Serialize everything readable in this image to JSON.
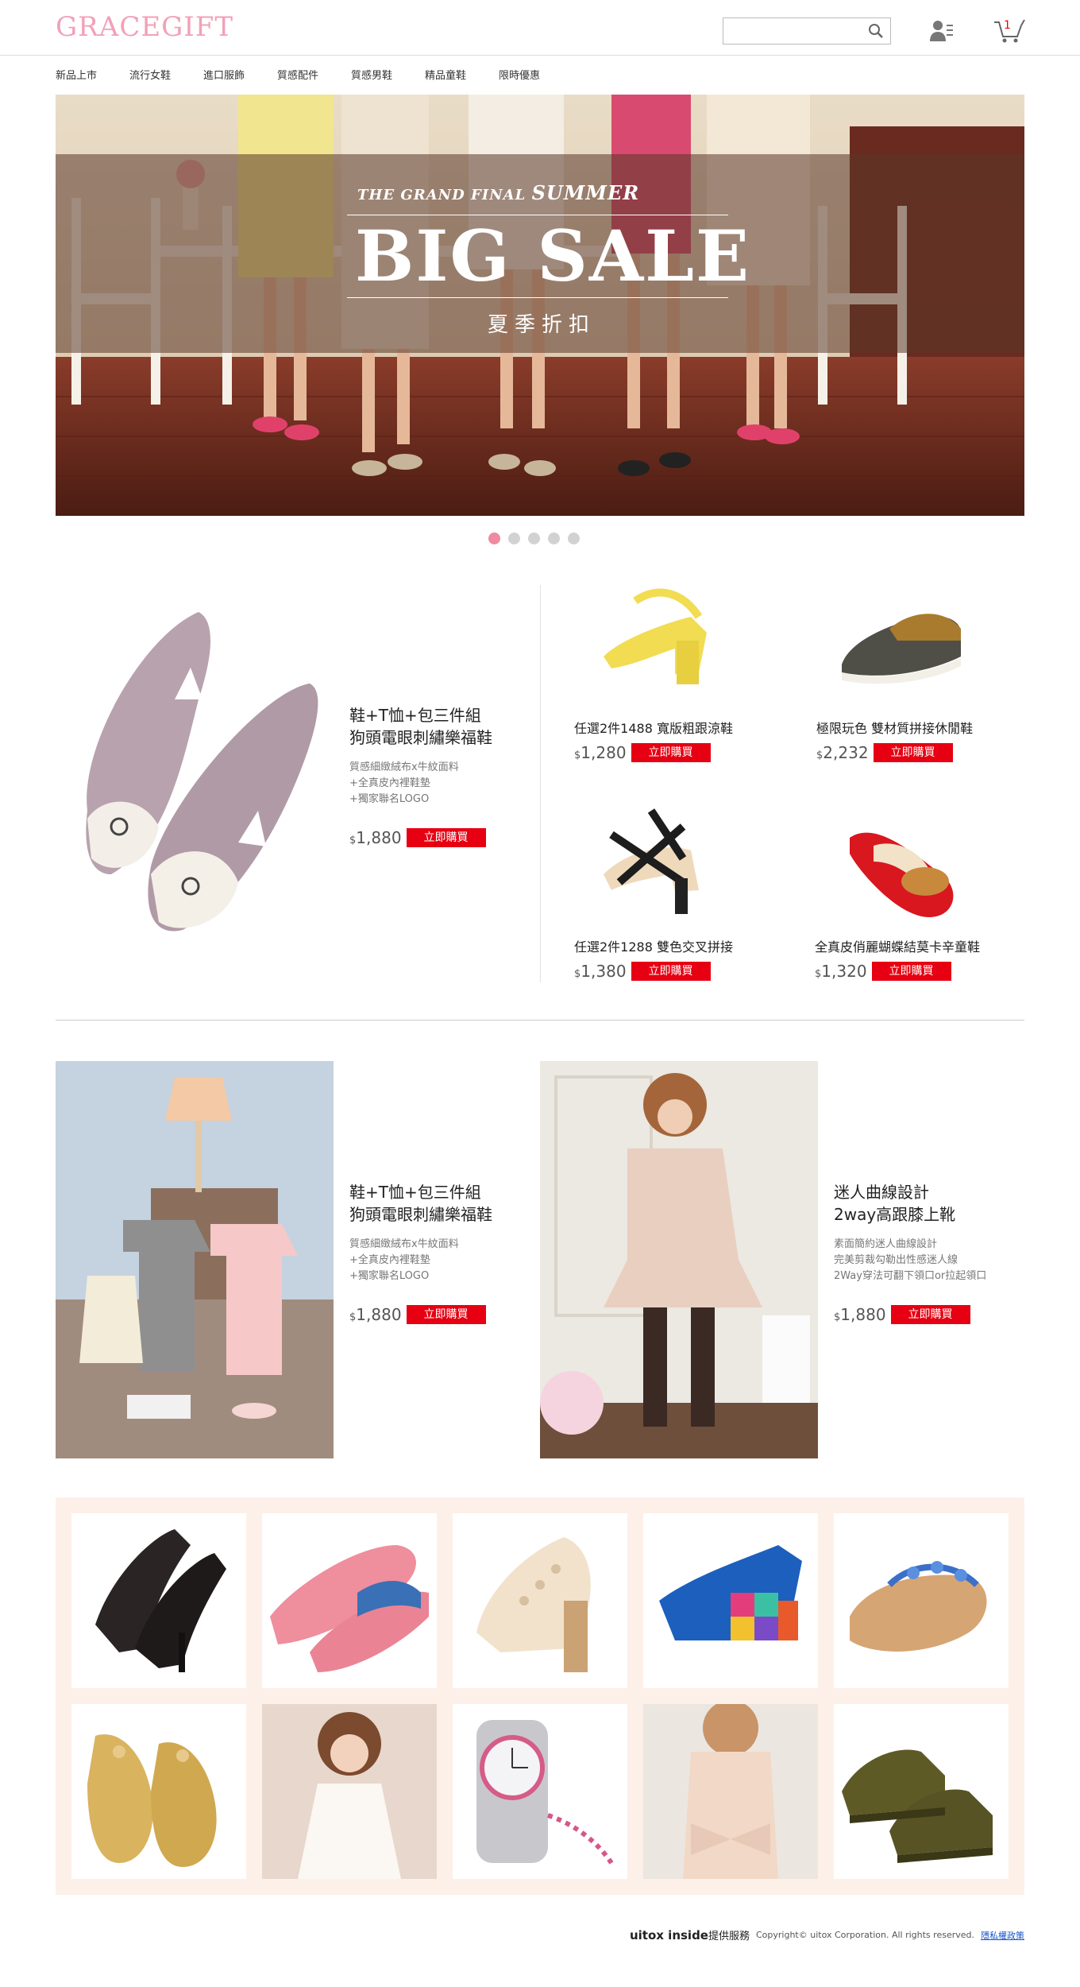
{
  "header": {
    "logo": "GRACEGIFT",
    "search": {
      "placeholder": ""
    },
    "cart_count": "1"
  },
  "nav": [
    "新品上市",
    "流行女鞋",
    "進口服飾",
    "質感配件",
    "質感男鞋",
    "精品童鞋",
    "限時優惠"
  ],
  "banner": {
    "subtitle_prefix": "THE GRAND FINAL",
    "subtitle_word": "SUMMER",
    "title": "BIG SALE",
    "chinese": "夏季折扣",
    "dots": 5,
    "active_dot": 0
  },
  "featured": {
    "title_line1": "鞋+T恤+包三件組",
    "title_line2": "狗頭電眼刺繡樂福鞋",
    "desc": [
      "質感細緻絨布x牛紋面料",
      "+全真皮內裡鞋墊",
      "+獨家聯名LOGO"
    ],
    "price": "1,880",
    "buy_label": "立即購買"
  },
  "small_products": [
    {
      "name": "任選2件1488  寬版粗跟涼鞋",
      "price": "1,280",
      "buy_label": "立即購買"
    },
    {
      "name": "極限玩色  雙材質拼接休閒鞋",
      "price": "2,232",
      "buy_label": "立即購買"
    },
    {
      "name": "任選2件1288  雙色交叉拼接",
      "price": "1,380",
      "buy_label": "立即購買"
    },
    {
      "name": "全真皮俏麗蝴蝶結莫卡辛童鞋",
      "price": "1,320",
      "buy_label": "立即購買"
    }
  ],
  "promo_left": {
    "title_line1": "鞋+T恤+包三件組",
    "title_line2": "狗頭電眼刺繡樂福鞋",
    "desc": [
      "質感細緻絨布x牛紋面料",
      "+全真皮內裡鞋墊",
      "+獨家聯名LOGO"
    ],
    "price": "1,880",
    "buy_label": "立即購買"
  },
  "promo_right": {
    "title_line1": "迷人曲線設計",
    "title_line2": "2way高跟膝上靴",
    "desc": [
      "素面簡約迷人曲線設計",
      "完美剪裁勾勒出性感迷人線",
      "2Way穿法可翻下領口or拉起領口"
    ],
    "price": "1,880",
    "buy_label": "立即購買"
  },
  "grid_items": [
    "lace-pumps",
    "pink-espadrilles",
    "cutout-heel-sandals",
    "colorblock-wedge",
    "jeweled-sandals",
    "glitter-kids-flats",
    "white-lace-dress",
    "crystal-watch",
    "bow-back-top",
    "suede-chukka"
  ],
  "footer": {
    "brand": "uitox inside",
    "service": "提供服務",
    "copyright": "Copyright© uitox Corporation. All rights reserved.",
    "privacy": "隱私權政策"
  },
  "colors": {
    "accent_red": "#e60012",
    "logo_pink": "#f2a0b8",
    "grid_bg": "#fdf0e8"
  }
}
